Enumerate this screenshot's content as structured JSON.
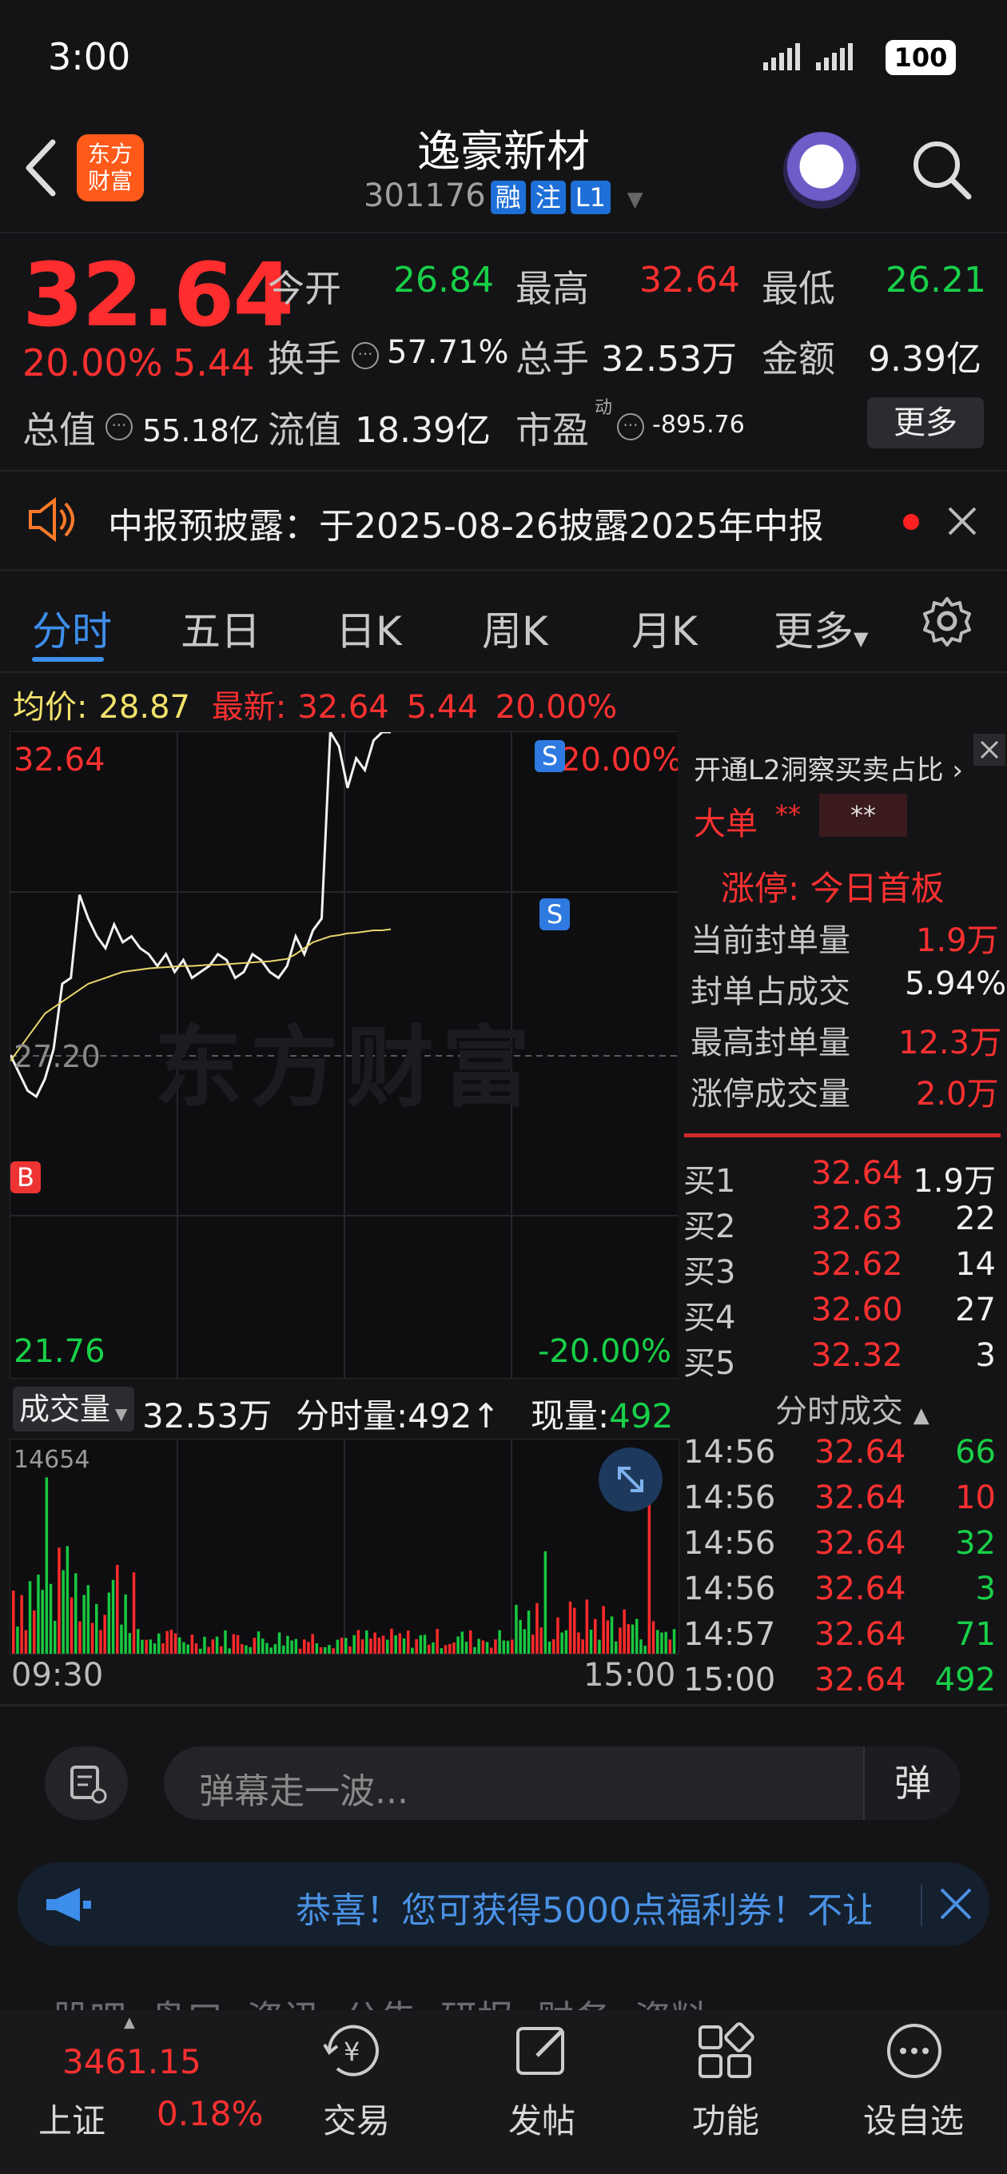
{
  "status": {
    "time": "3:00",
    "battery": "100"
  },
  "header": {
    "title": "逸豪新材",
    "code": "301176",
    "badges": [
      "融",
      "注",
      "L1"
    ],
    "logo_line1": "东方",
    "logo_line2": "财富"
  },
  "quote": {
    "price": "32.64",
    "change_pct": "20.00%",
    "change": "5.44",
    "open_label": "今开",
    "open": "26.84",
    "high_label": "最高",
    "high": "32.64",
    "low_label": "最低",
    "low": "26.21",
    "turnover_label": "换手",
    "turnover": "57.71%",
    "volume_label": "总手",
    "volume": "32.53万",
    "amount_label": "金额",
    "amount": "9.39亿",
    "mktcap_label": "总值",
    "mktcap": "55.18亿",
    "float_label": "流值",
    "float": "18.39亿",
    "pe_label": "市盈",
    "pe_sup": "动",
    "pe": "-895.76",
    "more_label": "更多"
  },
  "notice": {
    "text": "中报预披露：于2025-08-26披露2025年中报"
  },
  "tabs": [
    "分时",
    "五日",
    "日K",
    "周K",
    "月K",
    "更多"
  ],
  "chart": {
    "avg_label": "均价:",
    "avg": "28.87",
    "latest_label": "最新:",
    "latest": "32.64",
    "latest_change": "5.44",
    "latest_pct": "20.00%",
    "y_top": "32.64",
    "y_mid": "27.20",
    "y_bottom": "21.76",
    "pct_top": "20.00%",
    "pct_bottom": "-20.00%",
    "watermark": "东方财富",
    "marker_b": "B",
    "marker_s": "S",
    "vol_selector": "成交量",
    "vol_total": "32.53万",
    "vol_tick_label": "分时量:492↑",
    "vol_now_label": "现量:",
    "vol_now": "492",
    "vol_max": "14654",
    "time_start": "09:30",
    "time_end": "15:00"
  },
  "chart_data": {
    "type": "line",
    "series": [
      {
        "values": [
          27.2,
          26.9,
          26.6,
          26.5,
          26.8,
          27.3,
          28.4,
          28.5,
          29.9,
          29.5,
          29.2,
          29.0,
          29.4,
          29.1,
          29.2,
          29.0,
          28.9,
          28.7,
          28.9,
          28.6,
          28.8,
          28.5,
          28.6,
          28.7,
          28.9,
          28.8,
          28.5,
          28.6,
          28.9,
          28.8,
          28.6,
          28.5,
          28.7,
          29.2,
          28.9,
          29.3,
          29.5,
          32.64,
          32.4,
          31.7,
          32.2,
          32.0,
          32.5,
          32.64,
          32.64
        ]
      },
      {
        "values": [
          27.1,
          27.3,
          27.5,
          27.7,
          27.9,
          28.0,
          28.1,
          28.2,
          28.3,
          28.4,
          28.45,
          28.5,
          28.55,
          28.6,
          28.62,
          28.64,
          28.66,
          28.67,
          28.68,
          28.69,
          28.7,
          28.7,
          28.71,
          28.72,
          28.72,
          28.73,
          28.74,
          28.75,
          28.76,
          28.77,
          28.78,
          28.8,
          28.82,
          28.9,
          29.0,
          29.1,
          29.15,
          29.2,
          29.22,
          29.25,
          29.26,
          29.28,
          29.3,
          29.3,
          29.32
        ]
      }
    ],
    "ylim": [
      21.76,
      32.64
    ]
  },
  "level2": {
    "header": "开通L2洞察买卖占比",
    "big_order_label": "大单",
    "big_order_v1": "**",
    "big_order_v2": "**",
    "limit_up_title": "涨停: 今日首板",
    "rows": [
      {
        "label": "当前封单量",
        "value": "1.9万"
      },
      {
        "label": "封单占成交",
        "value": "5.94%"
      },
      {
        "label": "最高封单量",
        "value": "12.3万"
      },
      {
        "label": "涨停成交量",
        "value": "2.0万"
      }
    ]
  },
  "order_book": [
    {
      "label": "买1",
      "price": "32.64",
      "vol": "1.9万"
    },
    {
      "label": "买2",
      "price": "32.63",
      "vol": "22"
    },
    {
      "label": "买3",
      "price": "32.62",
      "vol": "14"
    },
    {
      "label": "买4",
      "price": "32.60",
      "vol": "27"
    },
    {
      "label": "买5",
      "price": "32.32",
      "vol": "3"
    }
  ],
  "ticks_header": "分时成交",
  "ticks": [
    {
      "time": "14:56",
      "price": "32.64",
      "vol": "66"
    },
    {
      "time": "14:56",
      "price": "32.64",
      "vol": "10"
    },
    {
      "time": "14:56",
      "price": "32.64",
      "vol": "32"
    },
    {
      "time": "14:56",
      "price": "32.64",
      "vol": "3"
    },
    {
      "time": "14:57",
      "price": "32.64",
      "vol": "71"
    },
    {
      "time": "15:00",
      "price": "32.64",
      "vol": "492"
    }
  ],
  "comment": {
    "placeholder": "弹幕走一波...",
    "button": "弹"
  },
  "banner": {
    "text": "恭喜！您可获得5000点福利券！不让"
  },
  "hidden_tabs": "股吧  盘口  资讯  公告  研报  财务  资料",
  "bottom_nav": {
    "index_value": "3461.15",
    "index_name": "上证",
    "index_pct": "0.18%",
    "items": [
      "交易",
      "发帖",
      "功能",
      "设自选"
    ]
  }
}
